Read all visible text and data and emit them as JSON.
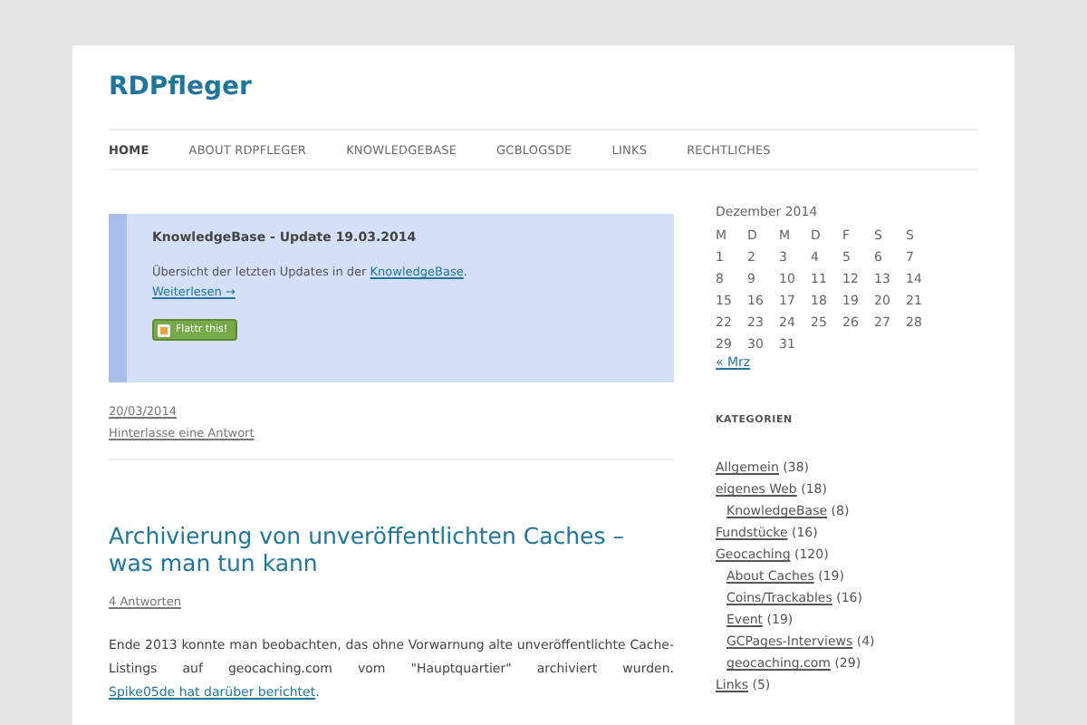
{
  "site": {
    "title": "RDPfleger"
  },
  "nav": [
    {
      "label": "HOME",
      "selected": true
    },
    {
      "label": "ABOUT RDPFLEGER",
      "selected": false
    },
    {
      "label": "KNOWLEDGEBASE",
      "selected": false
    },
    {
      "label": "GCBLOGSDE",
      "selected": false
    },
    {
      "label": "LINKS",
      "selected": false
    },
    {
      "label": "RECHTLICHES",
      "selected": false
    }
  ],
  "sticky_post": {
    "title": "KnowledgeBase - Update 19.03.2014",
    "text_before": "Übersicht der letzten Updates in der ",
    "link": "KnowledgeBase",
    "text_after": ".",
    "more": "Weiterlesen →",
    "flattr": "Flattr this!",
    "date": "20/03/2014",
    "reply": "Hinterlasse eine Antwort"
  },
  "post": {
    "title": "Archivierung von unveröffentlichten Caches – was man tun kann",
    "comments": "4 Antworten",
    "text": "Ende 2013 konnte man beobachten, das ohne Vorwarnung alte unveröffentlichte Cache-Listings auf geocaching.com vom \"Hauptquartier\" archiviert wurden. ",
    "link": "Spike05de hat darüber berichtet",
    "text_after": "."
  },
  "calendar": {
    "caption": "Dezember 2014",
    "weekdays": [
      "M",
      "D",
      "M",
      "D",
      "F",
      "S",
      "S"
    ],
    "weeks": [
      [
        "1",
        "2",
        "3",
        "4",
        "5",
        "6",
        "7"
      ],
      [
        "8",
        "9",
        "10",
        "11",
        "12",
        "13",
        "14"
      ],
      [
        "15",
        "16",
        "17",
        "18",
        "19",
        "20",
        "21"
      ],
      [
        "22",
        "23",
        "24",
        "25",
        "26",
        "27",
        "28"
      ],
      [
        "29",
        "30",
        "31"
      ]
    ],
    "prev": "« Mrz"
  },
  "categories": {
    "heading": "KATEGORIEN",
    "items": [
      {
        "name": "Allgemein",
        "count": "(38)"
      },
      {
        "name": "eigenes Web",
        "count": "(18)",
        "children": [
          {
            "name": "KnowledgeBase",
            "count": "(8)"
          }
        ]
      },
      {
        "name": "Fundstücke",
        "count": "(16)"
      },
      {
        "name": "Geocaching",
        "count": "(120)",
        "children": [
          {
            "name": "About Caches",
            "count": "(19)"
          },
          {
            "name": "Coins/Trackables",
            "count": "(16)"
          },
          {
            "name": "Event",
            "count": "(19)"
          },
          {
            "name": "GCPages-Interviews",
            "count": "(4)"
          },
          {
            "name": "geocaching.com",
            "count": "(29)"
          }
        ]
      },
      {
        "name": "Links",
        "count": "(5)"
      }
    ]
  }
}
